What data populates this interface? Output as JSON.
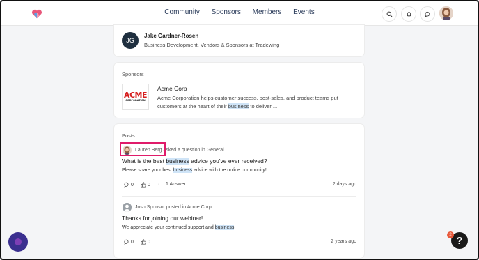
{
  "nav": {
    "items": [
      "Community",
      "Sponsors",
      "Members",
      "Events"
    ]
  },
  "member": {
    "initials": "JG",
    "name": "Jake Gardner-Rosen",
    "role": "Business Development, Vendors & Sponsors at Tradewing"
  },
  "sponsors": {
    "label": "Sponsors",
    "logo_word": "ACME",
    "logo_sub": "CORPORATION",
    "name": "Acme Corp",
    "desc_1": "Acme Corporation helps customer success, post-sales, and product teams put",
    "desc_2a": "customers at the heart of their ",
    "desc_2_hl": "business",
    "desc_2b": " to deliver ..."
  },
  "posts": {
    "label": "Posts",
    "items": [
      {
        "author": "Lauren Berg",
        "action": " asked a question in General",
        "title_a": "What is the best ",
        "title_hl": "business",
        "title_b": " advice you've ever received?",
        "body_a": "Please share your best ",
        "body_hl": "business",
        "body_b": " advice with the online community!",
        "comments": "0",
        "likes": "0",
        "sep": "·",
        "answers": "1 Answer",
        "time": "2 days ago"
      },
      {
        "author": "Josh Sponsor",
        "action": " posted in Acme Corp",
        "title": "Thanks for joining our webinar!",
        "body_a": "We appreciate your continued support and ",
        "body_hl": "business",
        "body_b": ".",
        "comments": "0",
        "likes": "0",
        "time": "2 years ago"
      }
    ]
  },
  "help": {
    "label": "?",
    "badge": "2"
  },
  "colors": {
    "accent_highlight": "#e01b6a",
    "search_highlight": "#cfe4f7",
    "brand_logo": "#e8567a"
  }
}
